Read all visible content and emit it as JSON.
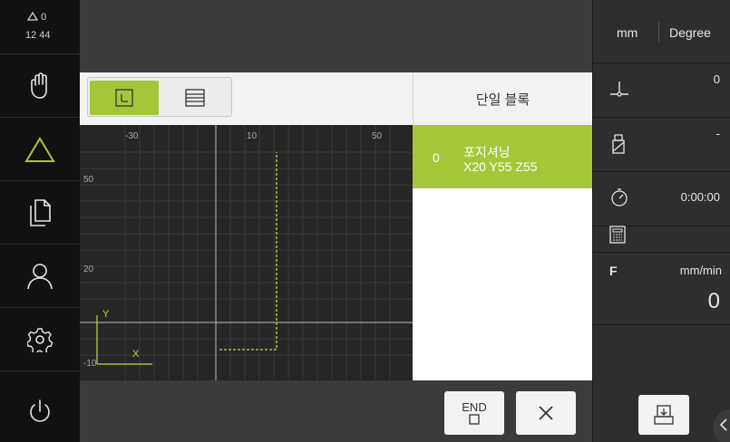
{
  "status": {
    "warnings": "0",
    "time": "12 44"
  },
  "sidebar": {
    "items": [
      {
        "name": "manual-mode",
        "icon": "hand-icon"
      },
      {
        "name": "mdi-mode",
        "icon": "triangle-icon",
        "active": true
      },
      {
        "name": "program-run",
        "icon": "documents-icon"
      },
      {
        "name": "user-login",
        "icon": "user-icon"
      },
      {
        "name": "settings",
        "icon": "gear-icon"
      },
      {
        "name": "power",
        "icon": "power-icon"
      }
    ]
  },
  "toolbar": {
    "view_graphic": "graphic-view-icon",
    "view_list": "list-view-icon"
  },
  "graphic": {
    "x_ticks": [
      "-30",
      "10",
      "50"
    ],
    "y_ticks": [
      "50",
      "20",
      "-10"
    ],
    "axis_y_label": "Y",
    "axis_x_label": "X"
  },
  "blocks": {
    "header": "단일 블록",
    "items": [
      {
        "number": "0",
        "title": "포지셔닝",
        "params": "X20  Y55  Z55"
      }
    ]
  },
  "bottom": {
    "end_label": "END",
    "cancel_icon": "close-icon"
  },
  "right_panel": {
    "unit_length": "mm",
    "unit_angle": "Degree",
    "position_value": "0",
    "tool_value": "-",
    "timer_value": "0:00:00",
    "feed_label": "F",
    "feed_unit": "mm/min",
    "feed_value": "0"
  },
  "colors": {
    "accent": "#a6c63a",
    "dashed_path": "#c8d84a"
  }
}
